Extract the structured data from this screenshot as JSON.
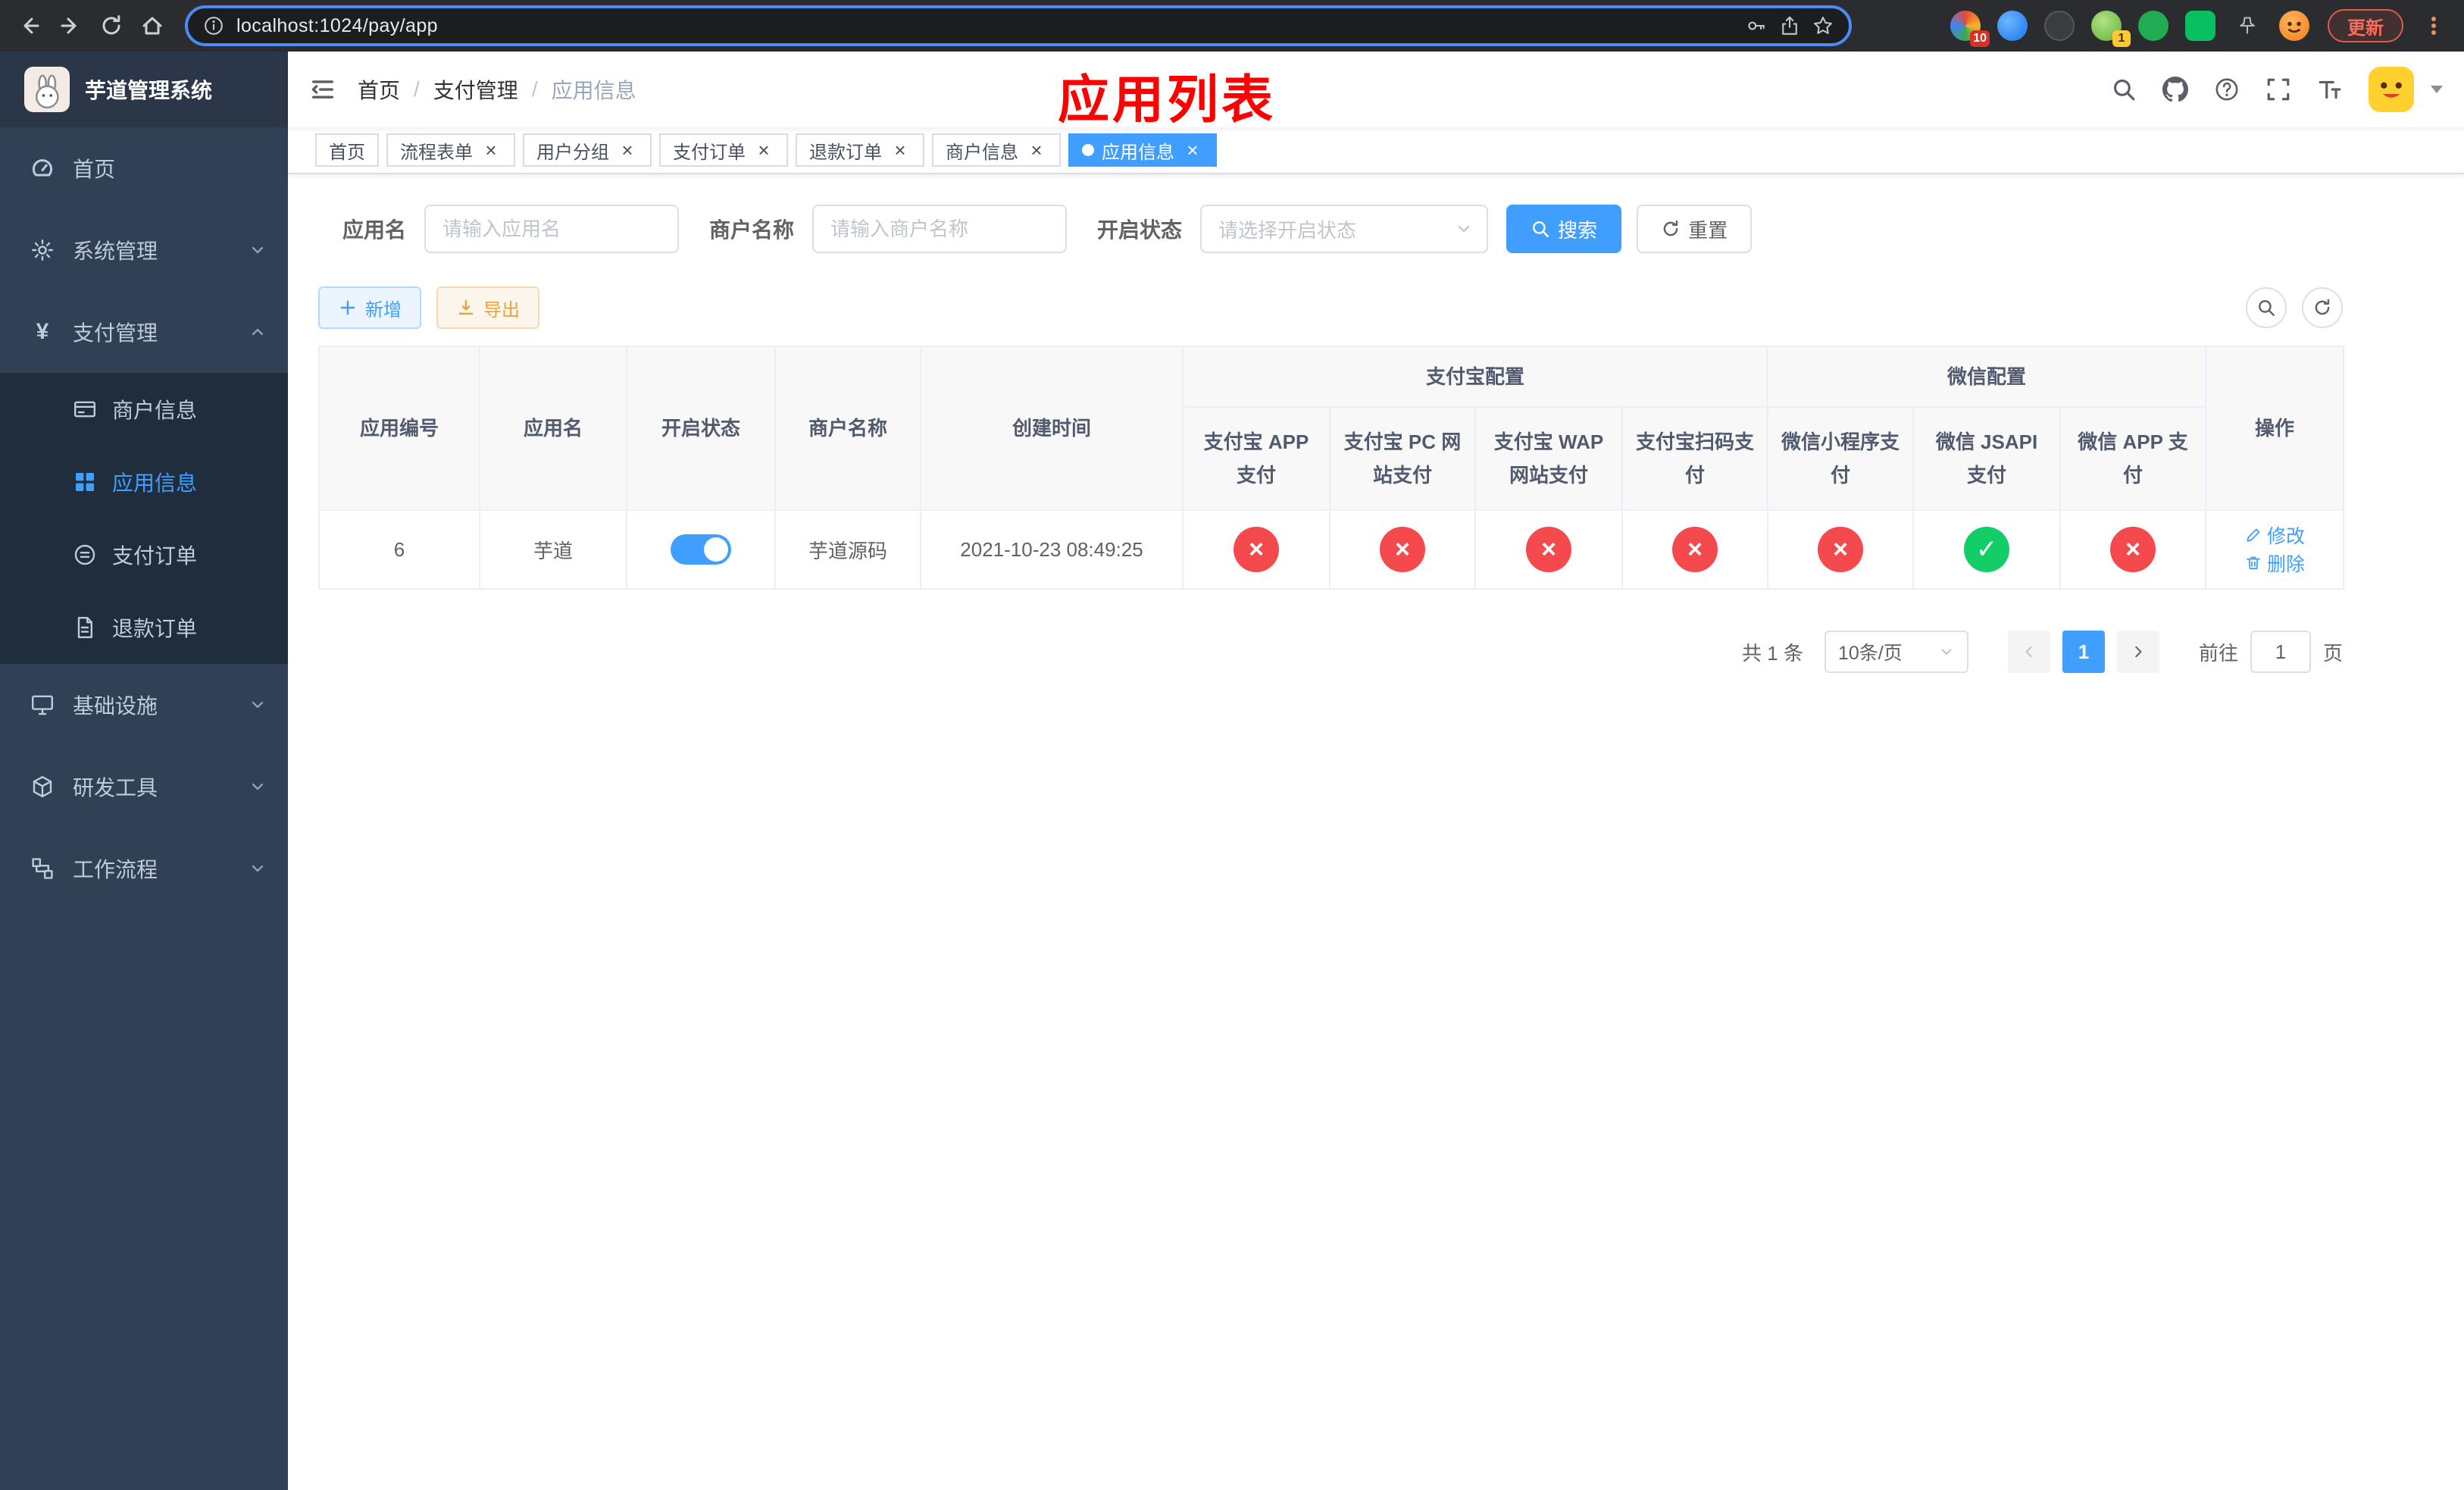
{
  "colors": {
    "primary": "#409eff",
    "success": "#13ce66",
    "danger": "#f4494d",
    "warning": "#e6a23c",
    "sidebar_bg": "#304156",
    "submenu_bg": "#1f2d3d",
    "annotation_red": "#fe0000"
  },
  "icons": {
    "ok_glyph": "✓",
    "fail_glyph": "×"
  },
  "browser": {
    "url": "localhost:1024/pay/app",
    "update_label": "更新",
    "extension_badge_first": "10",
    "extension_badge_fourth": "1"
  },
  "sidebar": {
    "title": "芋道管理系统",
    "items": [
      {
        "label": "首页"
      },
      {
        "label": "系统管理"
      },
      {
        "label": "支付管理",
        "children": [
          {
            "label": "商户信息"
          },
          {
            "label": "应用信息",
            "active": true
          },
          {
            "label": "支付订单"
          },
          {
            "label": "退款订单"
          }
        ]
      },
      {
        "label": "基础设施"
      },
      {
        "label": "研发工具"
      },
      {
        "label": "工作流程"
      }
    ]
  },
  "navbar": {
    "breadcrumb": [
      "首页",
      "支付管理",
      "应用信息"
    ],
    "annotation": "应用列表"
  },
  "tags": [
    {
      "label": "首页",
      "closable": false,
      "active": false
    },
    {
      "label": "流程表单",
      "closable": true,
      "active": false
    },
    {
      "label": "用户分组",
      "closable": true,
      "active": false
    },
    {
      "label": "支付订单",
      "closable": true,
      "active": false
    },
    {
      "label": "退款订单",
      "closable": true,
      "active": false
    },
    {
      "label": "商户信息",
      "closable": true,
      "active": false
    },
    {
      "label": "应用信息",
      "closable": true,
      "active": true
    }
  ],
  "filters": {
    "app_name_label": "应用名",
    "app_name_placeholder": "请输入应用名",
    "merchant_label": "商户名称",
    "merchant_placeholder": "请输入商户名称",
    "status_label": "开启状态",
    "status_placeholder": "请选择开启状态",
    "search_button": "搜索",
    "reset_button": "重置"
  },
  "toolbar": {
    "add_button": "新增",
    "export_button": "导出"
  },
  "table": {
    "group_alipay": "支付宝配置",
    "group_wechat": "微信配置",
    "columns": [
      "应用编号",
      "应用名",
      "开启状态",
      "商户名称",
      "创建时间",
      "支付宝 APP 支付",
      "支付宝 PC 网站支付",
      "支付宝 WAP 网站支付",
      "支付宝扫码支付",
      "微信小程序支付",
      "微信 JSAPI 支付",
      "微信 APP 支付",
      "操作"
    ],
    "row": {
      "id": "6",
      "name": "芋道",
      "enabled": true,
      "merchant": "芋道源码",
      "created": "2021-10-23 08:49:25",
      "statuses": [
        "fail",
        "fail",
        "fail",
        "fail",
        "fail",
        "ok",
        "fail"
      ],
      "edit_label": "修改",
      "delete_label": "删除"
    }
  },
  "pagination": {
    "total": "共 1 条",
    "page_size": "10条/页",
    "page": "1",
    "goto_label": "前往",
    "goto_value": "1",
    "unit_label": "页"
  }
}
